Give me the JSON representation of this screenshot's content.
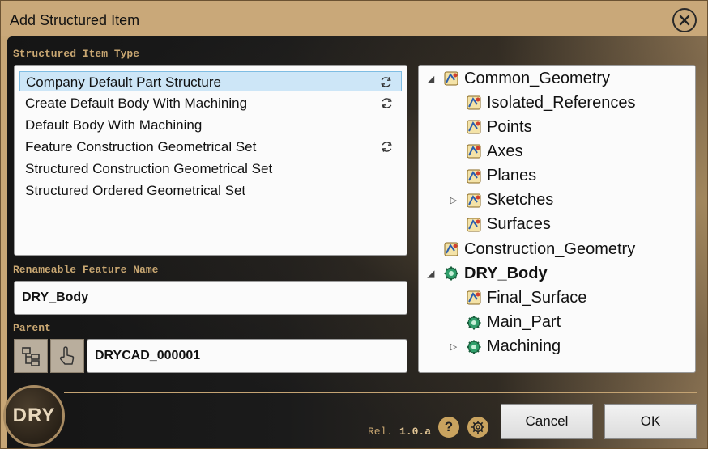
{
  "window": {
    "title": "Add Structured Item"
  },
  "structured_item_type": {
    "label": "Structured Item Type",
    "items": [
      {
        "label": "Company Default Part Structure",
        "selected": true,
        "sync_icon": true
      },
      {
        "label": "Create Default Body With Machining",
        "selected": false,
        "sync_icon": true
      },
      {
        "label": "Default Body With Machining",
        "selected": false,
        "sync_icon": false
      },
      {
        "label": "Feature Construction Geometrical Set",
        "selected": false,
        "sync_icon": true
      },
      {
        "label": "Structured Construction Geometrical Set",
        "selected": false,
        "sync_icon": false
      },
      {
        "label": "Structured Ordered Geometrical Set",
        "selected": false,
        "sync_icon": false
      }
    ]
  },
  "renameable": {
    "label": "Renameable Feature Name",
    "value": "DRY_Body"
  },
  "parent": {
    "label": "Parent",
    "value": "DRYCAD_000001"
  },
  "tree": [
    {
      "label": "Common_Geometry",
      "level": 0,
      "expander": "expanded",
      "icon": "geometrical-set-icon",
      "bold": false
    },
    {
      "label": "Isolated_References",
      "level": 1,
      "expander": "none",
      "icon": "geometrical-set-icon",
      "bold": false
    },
    {
      "label": "Points",
      "level": 1,
      "expander": "none",
      "icon": "geometrical-set-icon",
      "bold": false
    },
    {
      "label": "Axes",
      "level": 1,
      "expander": "none",
      "icon": "geometrical-set-icon",
      "bold": false
    },
    {
      "label": "Planes",
      "level": 1,
      "expander": "none",
      "icon": "geometrical-set-icon",
      "bold": false
    },
    {
      "label": "Sketches",
      "level": 1,
      "expander": "collapsed",
      "icon": "geometrical-set-icon",
      "bold": false
    },
    {
      "label": "Surfaces",
      "level": 1,
      "expander": "none",
      "icon": "geometrical-set-icon",
      "bold": false
    },
    {
      "label": "Construction_Geometry",
      "level": 0,
      "expander": "none",
      "icon": "geometrical-set-icon",
      "bold": false
    },
    {
      "label": "DRY_Body",
      "level": 0,
      "expander": "expanded",
      "icon": "body-gear-icon",
      "bold": true
    },
    {
      "label": "Final_Surface",
      "level": 1,
      "expander": "none",
      "icon": "geometrical-set-icon",
      "bold": false
    },
    {
      "label": "Main_Part",
      "level": 1,
      "expander": "none",
      "icon": "body-gear-icon",
      "bold": false
    },
    {
      "label": "Machining",
      "level": 1,
      "expander": "collapsed",
      "icon": "body-gear-icon",
      "bold": false
    }
  ],
  "footer": {
    "logo_text": "DRY",
    "rel_prefix": "Rel.",
    "rel_version": "1.0.a",
    "cancel_label": "Cancel",
    "ok_label": "OK"
  },
  "colors": {
    "accent": "#c9a772",
    "selection": "#cde6f7",
    "title_bar": "#c9a879"
  }
}
